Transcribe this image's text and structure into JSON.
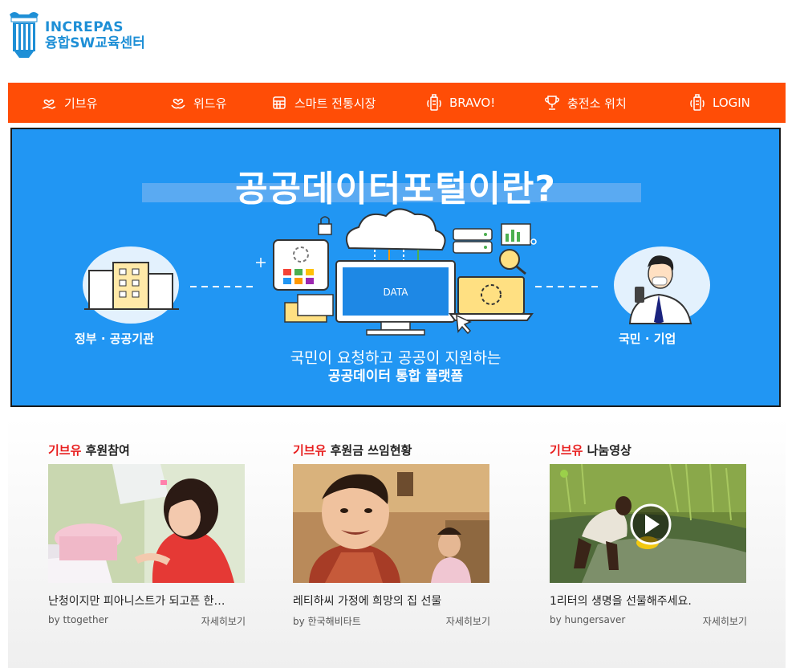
{
  "logo": {
    "en": "INCREPAS",
    "ko": "융합SW교육센터",
    "mark_text": "INCREPAS"
  },
  "nav": {
    "items": [
      {
        "label": "기브유",
        "icon": "hand-heart-icon"
      },
      {
        "label": "위드유",
        "icon": "hands-heart-icon"
      },
      {
        "label": "스마트 전통시장",
        "icon": "store-icon"
      },
      {
        "label": "BRAVO!",
        "icon": "battery-icon"
      },
      {
        "label": "충전소 위치",
        "icon": "trophy-icon"
      },
      {
        "label": "LOGIN",
        "icon": "battery-icon"
      }
    ]
  },
  "banner": {
    "title": "공공데이터포털이란?",
    "left_label": "정부 · 공공기관",
    "right_label": "국민 · 기업",
    "sub1": "국민이 요청하고 공공이 지원하는",
    "sub2": "공공데이터 통합 플랫폼",
    "monitor_text": "DATA"
  },
  "cards": [
    {
      "brand": "기브유",
      "heading": " 후원참여",
      "title": "난청이지만 피아니스트가 되고픈 한…",
      "by": "by ttogether",
      "more": "자세히보기"
    },
    {
      "brand": "기브유",
      "heading": " 후원금 쓰임현황",
      "title": "레티하씨 가정에 희망의 집 선물",
      "by": "by 한국해비타트",
      "more": "자세히보기"
    },
    {
      "brand": "기브유",
      "heading": " 나눔영상",
      "title": "1리터의 생명을 선물해주세요.",
      "by": "by hungersaver",
      "more": "자세히보기"
    }
  ],
  "colors": {
    "accent": "#ff4d06",
    "banner": "#2196f3",
    "highlight": "#e81e1e",
    "logo": "#1e8fd6"
  }
}
